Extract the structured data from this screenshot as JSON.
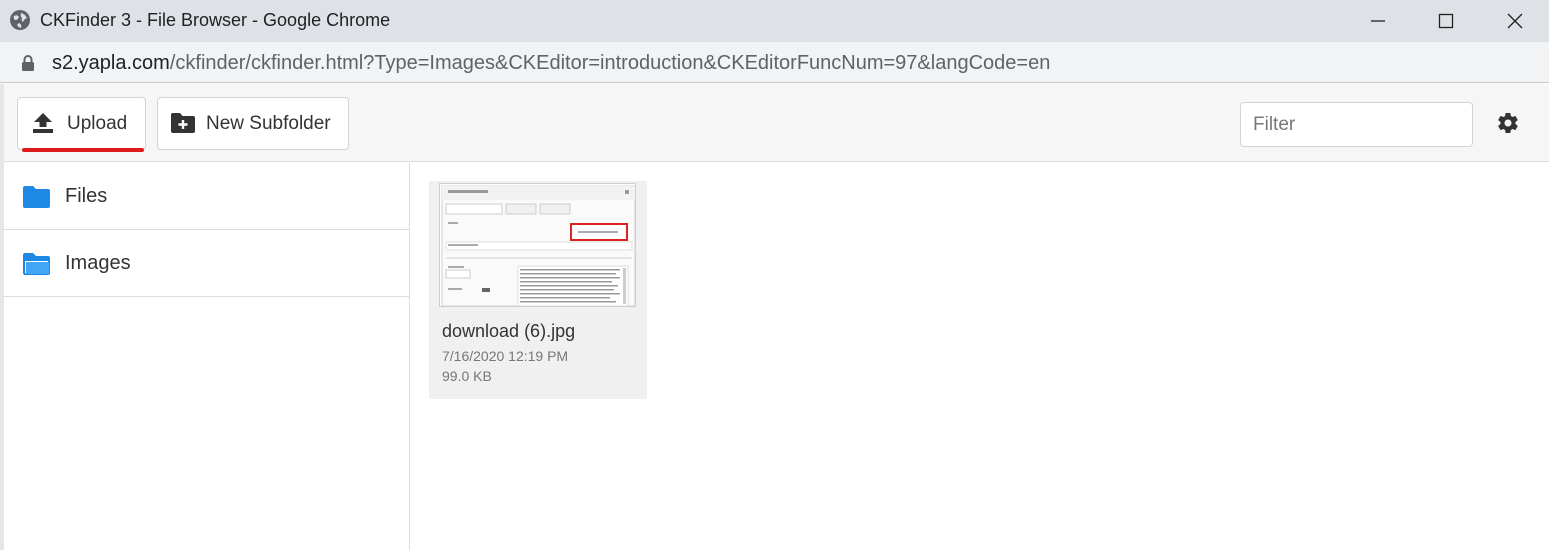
{
  "window": {
    "title": "CKFinder 3 - File Browser - Google Chrome"
  },
  "address": {
    "host": "s2.yapla.com",
    "path": "/ckfinder/ckfinder.html?Type=Images&CKEditor=introduction&CKEditorFuncNum=97&langCode=en"
  },
  "toolbar": {
    "upload_label": "Upload",
    "new_subfolder_label": "New Subfolder",
    "filter_placeholder": "Filter"
  },
  "sidebar": {
    "items": [
      {
        "label": "Files",
        "icon": "folder-icon"
      },
      {
        "label": "Images",
        "icon": "folder-open-icon"
      }
    ]
  },
  "files": [
    {
      "name": "download (6).jpg",
      "date": "7/16/2020 12:19 PM",
      "size": "99.0 KB"
    }
  ],
  "colors": {
    "accent_underline": "#e01b1b",
    "folder_blue": "#1e88e5"
  }
}
